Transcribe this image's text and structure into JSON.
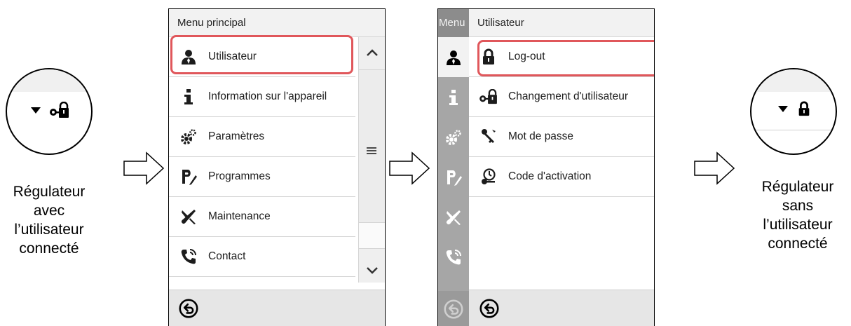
{
  "left_caption": [
    "Régulateur",
    "avec",
    "l’utilisateur",
    "connecté"
  ],
  "right_caption": [
    "Régulateur",
    "sans",
    "l’utilisateur",
    "connecté"
  ],
  "panel1": {
    "title": "Menu principal",
    "items": [
      {
        "label": "Utilisateur",
        "icon": "user-icon"
      },
      {
        "label": "Information sur l'appareil",
        "icon": "info-icon"
      },
      {
        "label": "Paramètres",
        "icon": "gears-icon"
      },
      {
        "label": "Programmes",
        "icon": "programs-icon"
      },
      {
        "label": "Maintenance",
        "icon": "maintenance-icon"
      },
      {
        "label": "Contact",
        "icon": "phone-icon"
      }
    ],
    "highlighted_index": 0
  },
  "panel2": {
    "side_title": "Menu",
    "title": "Utilisateur",
    "items": [
      {
        "label": "Log-out",
        "icon": "lock-closed-icon"
      },
      {
        "label": "Changement d'utilisateur",
        "icon": "key-lock-icon"
      },
      {
        "label": "Mot de passe",
        "icon": "key-icon"
      },
      {
        "label": "Code d'activation",
        "icon": "activation-code-icon"
      }
    ],
    "highlighted_index": 0
  },
  "colors": {
    "highlight": "#e0575b",
    "sidebar": "#a6a6a6",
    "header": "#f2f2f2"
  }
}
